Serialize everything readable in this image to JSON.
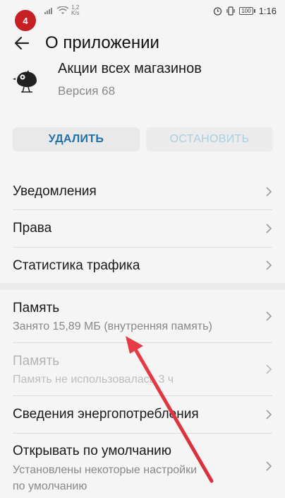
{
  "status_bar": {
    "notification_count": "4",
    "net_speed_value": "1,2",
    "net_speed_unit": "K/s",
    "battery": "100",
    "time": "1:16"
  },
  "toolbar": {
    "title": "О приложении"
  },
  "app": {
    "name": "Акции всех магазинов",
    "version": "Версия 68"
  },
  "actions": {
    "delete_label": "УДАЛИТЬ",
    "stop_label": "ОСТАНОВИТЬ"
  },
  "settings": {
    "notifications": "Уведомления",
    "permissions": "Права",
    "traffic": "Статистика трафика",
    "storage_title": "Память",
    "storage_sub": "Занято 15,89 МБ (внутренняя память)",
    "memory_title": "Память",
    "memory_sub": "Память не использовалась 3 ч",
    "power": "Сведения энергопотребления",
    "open_default_title": "Открывать по умолчанию",
    "open_default_sub_1": "Установлены некоторые настройки",
    "open_default_sub_2": "по умолчанию"
  },
  "colors": {
    "badge": "#c62025",
    "delete_text": "#1e72a8",
    "stop_text_disabled": "#a8cfe3",
    "annotation_arrow": "#e63b46"
  },
  "icons": [
    "back-arrow-icon",
    "bird-app-icon",
    "chevron-right-icon",
    "alarm-icon",
    "vibrate-icon",
    "wifi-icon",
    "signal-icon",
    "battery-icon"
  ]
}
